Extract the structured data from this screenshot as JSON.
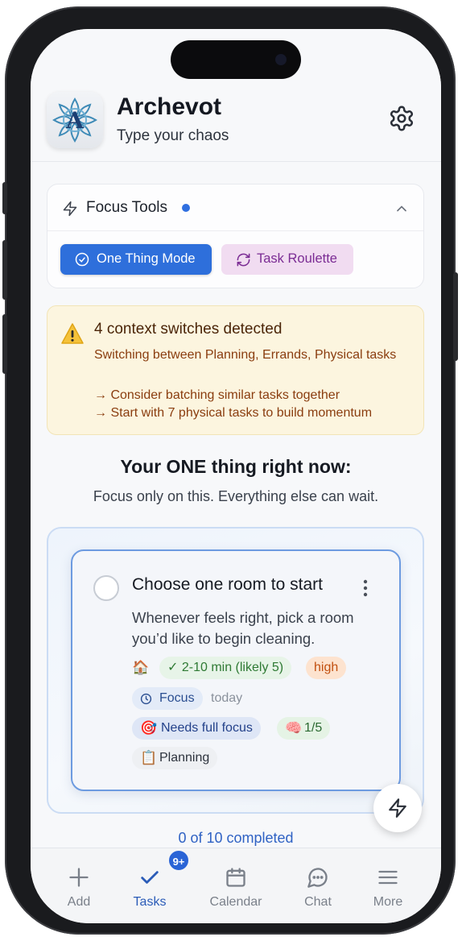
{
  "header": {
    "app_title": "Archevot",
    "subtitle": "Type your chaos",
    "logo_letter": "A"
  },
  "focus_tools": {
    "title": "Focus Tools",
    "expanded": true,
    "one_thing_label": "One Thing Mode",
    "roulette_label": "Task Roulette"
  },
  "warning": {
    "title": "4 context switches detected",
    "description": "Switching between Planning, Errands, Physical tasks",
    "tips": [
      "→ Consider batching similar tasks together",
      "→ Start with 7 physical tasks to build momentum"
    ]
  },
  "one_thing": {
    "heading": "Your ONE thing right now:",
    "subheading": "Focus only on this. Everything else can wait."
  },
  "task": {
    "title": "Choose one room to start",
    "description": "Whenever feels right, pick a room you’d like to begin cleaning.",
    "category_emoji": "🏠",
    "duration": "✓ 2-10 min (likely 5)",
    "priority": "high",
    "context": "Focus",
    "due": "today",
    "energy_emoji": "🎯",
    "energy": "Needs full focus",
    "cognitive_emoji": "🧠",
    "cognitive": "1/5",
    "type_emoji": "📋",
    "type": "Planning"
  },
  "progress": {
    "completed_text": "0 of 10 completed",
    "completed": 0,
    "total": 10
  },
  "nav": {
    "items": [
      {
        "label": "Add",
        "icon": "plus-icon"
      },
      {
        "label": "Tasks",
        "icon": "check-icon",
        "badge": "9+"
      },
      {
        "label": "Calendar",
        "icon": "calendar-icon"
      },
      {
        "label": "Chat",
        "icon": "chat-icon"
      },
      {
        "label": "More",
        "icon": "menu-icon"
      }
    ],
    "active": "Tasks"
  },
  "colors": {
    "accent": "#2e6fdb",
    "warning_bg": "#fcf5df",
    "roulette_bg": "#f1dcf1"
  }
}
